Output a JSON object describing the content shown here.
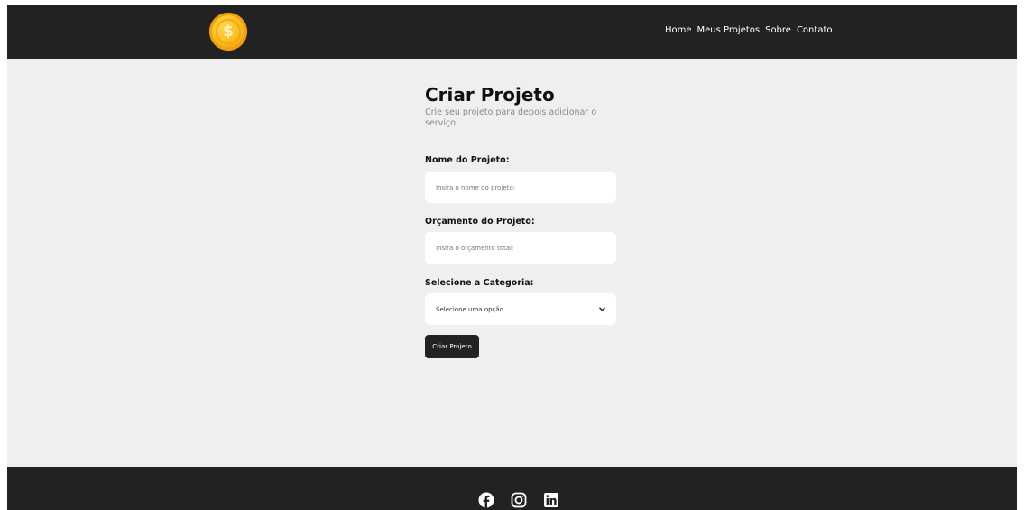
{
  "navbar": {
    "logo_icon": "dollar-coin-icon",
    "logo_symbol": "$",
    "links": [
      {
        "label": "Home"
      },
      {
        "label": "Meus Projetos"
      },
      {
        "label": "Sobre"
      },
      {
        "label": "Contato"
      }
    ]
  },
  "form": {
    "title": "Criar Projeto",
    "subtitle": "Crie seu projeto para depois adicionar o serviço",
    "name_label": "Nome do Projeto:",
    "name_placeholder": "Insira o nome do projeto:",
    "budget_label": "Orçamento do Projeto:",
    "budget_placeholder": "Insira o orçamento total:",
    "category_label": "Selecione a Categoria:",
    "category_selected": "Selecione uma opção",
    "submit_label": "Criar Projeto"
  },
  "footer": {
    "social_icons": [
      "facebook-icon",
      "instagram-icon",
      "linkedin-icon"
    ]
  },
  "colors": {
    "nav_bg": "#222222",
    "page_bg": "#efefef",
    "accent_coin": "#fbbf24"
  }
}
